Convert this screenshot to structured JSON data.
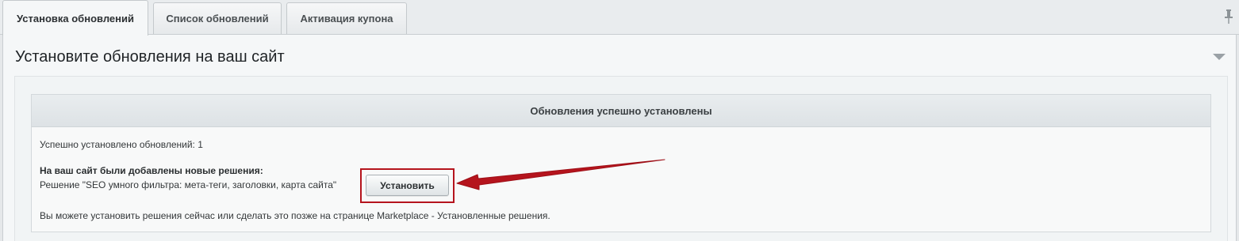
{
  "tabs": [
    {
      "label": "Установка обновлений",
      "active": true
    },
    {
      "label": "Список обновлений",
      "active": false
    },
    {
      "label": "Активация купона",
      "active": false
    }
  ],
  "icons": {
    "pin": "pin-icon",
    "collapse": "chevron-down-icon",
    "arrow": "red-arrow-annotation"
  },
  "panel": {
    "title": "Установите обновления на ваш сайт"
  },
  "result": {
    "header": "Обновления успешно установлены",
    "installed_count_text": "Успешно установлено обновлений: 1",
    "new_solutions_heading": "На ваш сайт были добавлены новые решения:",
    "solution_text": "Решение \"SEO умного фильтра: мета-теги, заголовки, карта сайта\"",
    "install_button_label": "Установить",
    "footer_note": "Вы можете установить решения сейчас или сделать это позже на странице Marketplace - Установленные решения."
  },
  "colors": {
    "annotation_red": "#b5141d"
  }
}
